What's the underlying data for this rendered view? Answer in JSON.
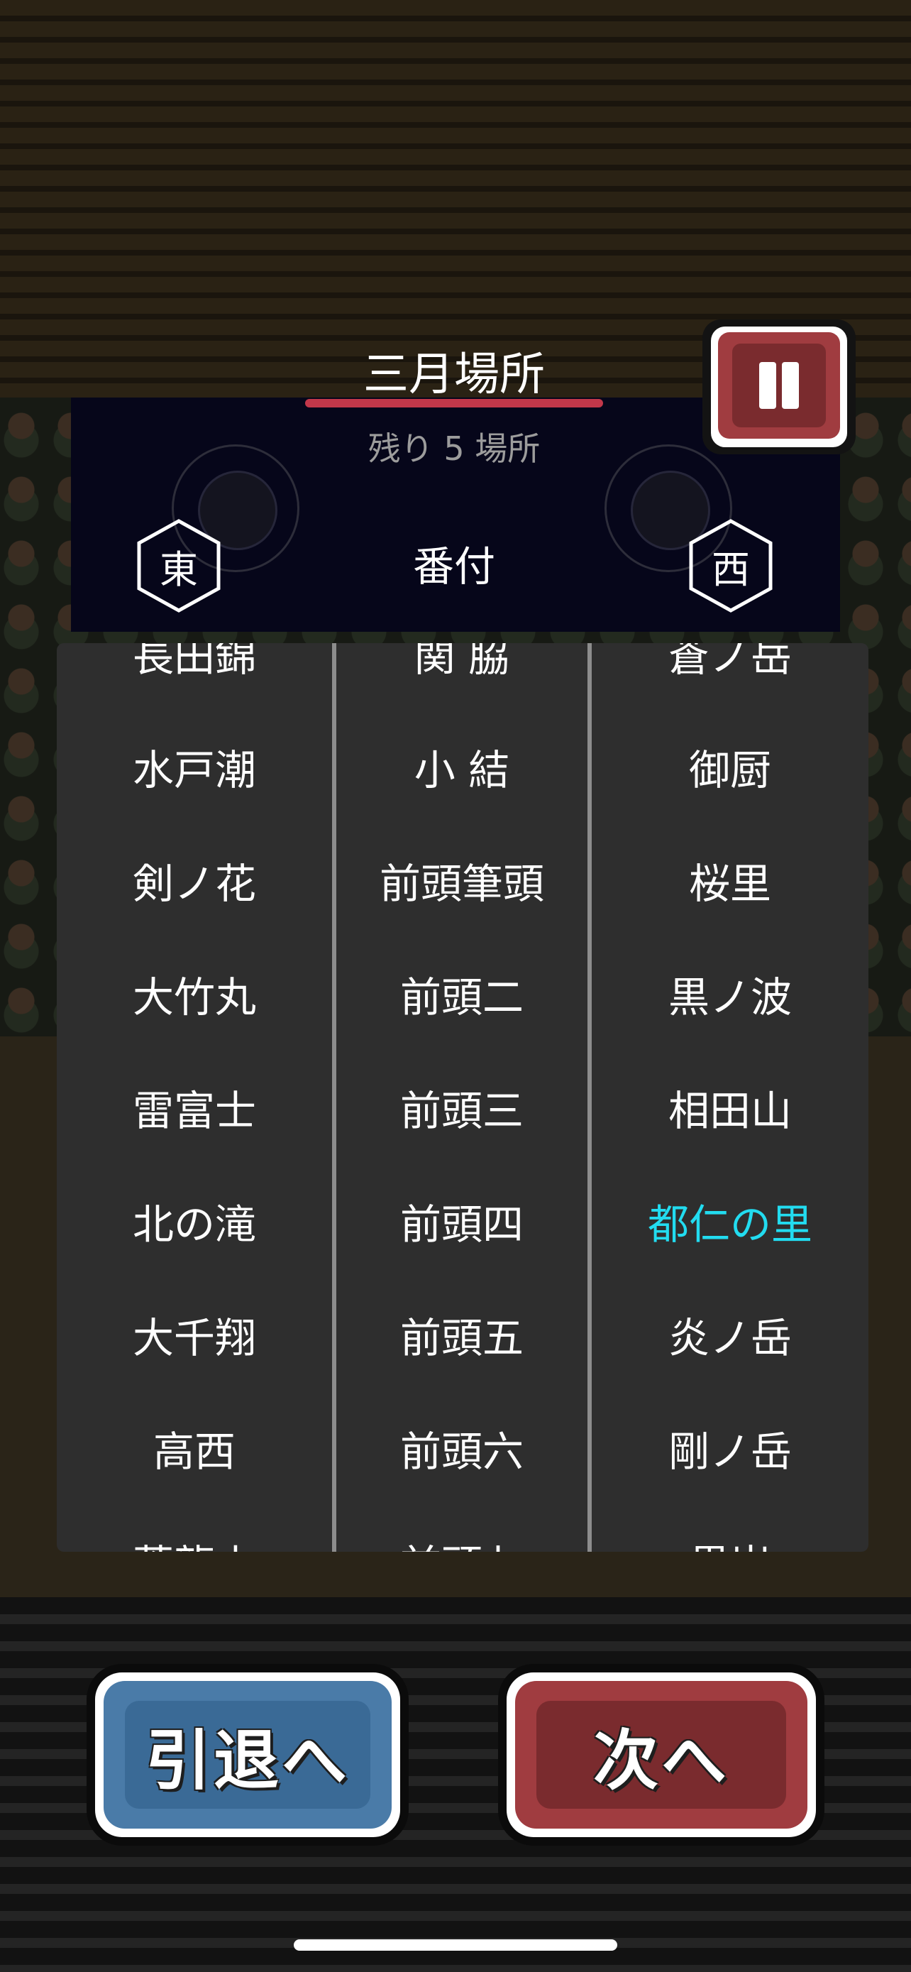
{
  "header": {
    "title": "三月場所",
    "remaining": "残り 5 場所",
    "east_label": "東",
    "rank_label": "番付",
    "west_label": "西"
  },
  "banzuke": {
    "east": [
      "長田錦",
      "水戸潮",
      "剣ノ花",
      "大竹丸",
      "雷富士",
      "北の滝",
      "大千翔",
      "高西",
      "蒼龍山"
    ],
    "rank": [
      "関 脇",
      "小 結",
      "前頭筆頭",
      "前頭二",
      "前頭三",
      "前頭四",
      "前頭五",
      "前頭六",
      "前頭七"
    ],
    "west": [
      "蒼ノ岳",
      "御厨",
      "桜里",
      "黒ノ波",
      "相田山",
      "都仁の里",
      "炎ノ岳",
      "剛ノ岳",
      "黒岩"
    ],
    "highlight": {
      "column": "west",
      "index": 5,
      "color": "#22dcf0"
    }
  },
  "buttons": {
    "retire_label": "引退へ",
    "next_label": "次へ",
    "pause_icon": "pause-icon"
  },
  "colors": {
    "retire_button": "#4a7ba8",
    "next_button": "#a03c40",
    "title_underline": "#c2374a"
  }
}
